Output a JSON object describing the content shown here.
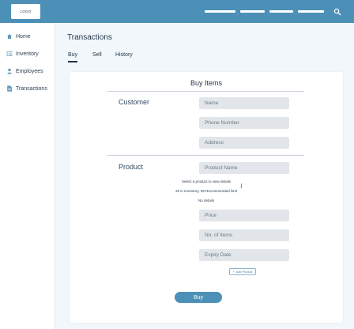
{
  "header": {
    "logo_text": "LOGO",
    "nav_icons": [
      "menu-line-icon",
      "menu-line-icon",
      "menu-line-icon",
      "menu-line-icon",
      "search-icon"
    ],
    "brand_color": "#4c90b8"
  },
  "sidebar": {
    "items": [
      {
        "label": "Home",
        "icon": "home-icon"
      },
      {
        "label": "Inventory",
        "icon": "list-icon"
      },
      {
        "label": "Employees",
        "icon": "person-icon"
      },
      {
        "label": "Transactions",
        "icon": "document-icon"
      }
    ]
  },
  "main": {
    "title": "Transactions",
    "tabs": [
      {
        "label": "Buy",
        "active": true
      },
      {
        "label": "Sell",
        "active": false
      },
      {
        "label": "History",
        "active": false
      }
    ]
  },
  "form": {
    "title": "Buy Items",
    "customer": {
      "label": "Customer",
      "fields": [
        {
          "placeholder": "Name"
        },
        {
          "placeholder": "Phone Number"
        },
        {
          "placeholder": "Address"
        }
      ]
    },
    "product": {
      "label": "Product",
      "name_placeholder": "Product Name",
      "info_lines": [
        "Select a product to view details",
        "20 in Inventory, 05 Recommended limit",
        "No details"
      ],
      "fields": [
        {
          "placeholder": "Price"
        },
        {
          "placeholder": "No. of Items"
        },
        {
          "placeholder": "Expiry Date"
        }
      ],
      "add_button_label": "Add Product"
    },
    "submit_label": "Buy"
  }
}
